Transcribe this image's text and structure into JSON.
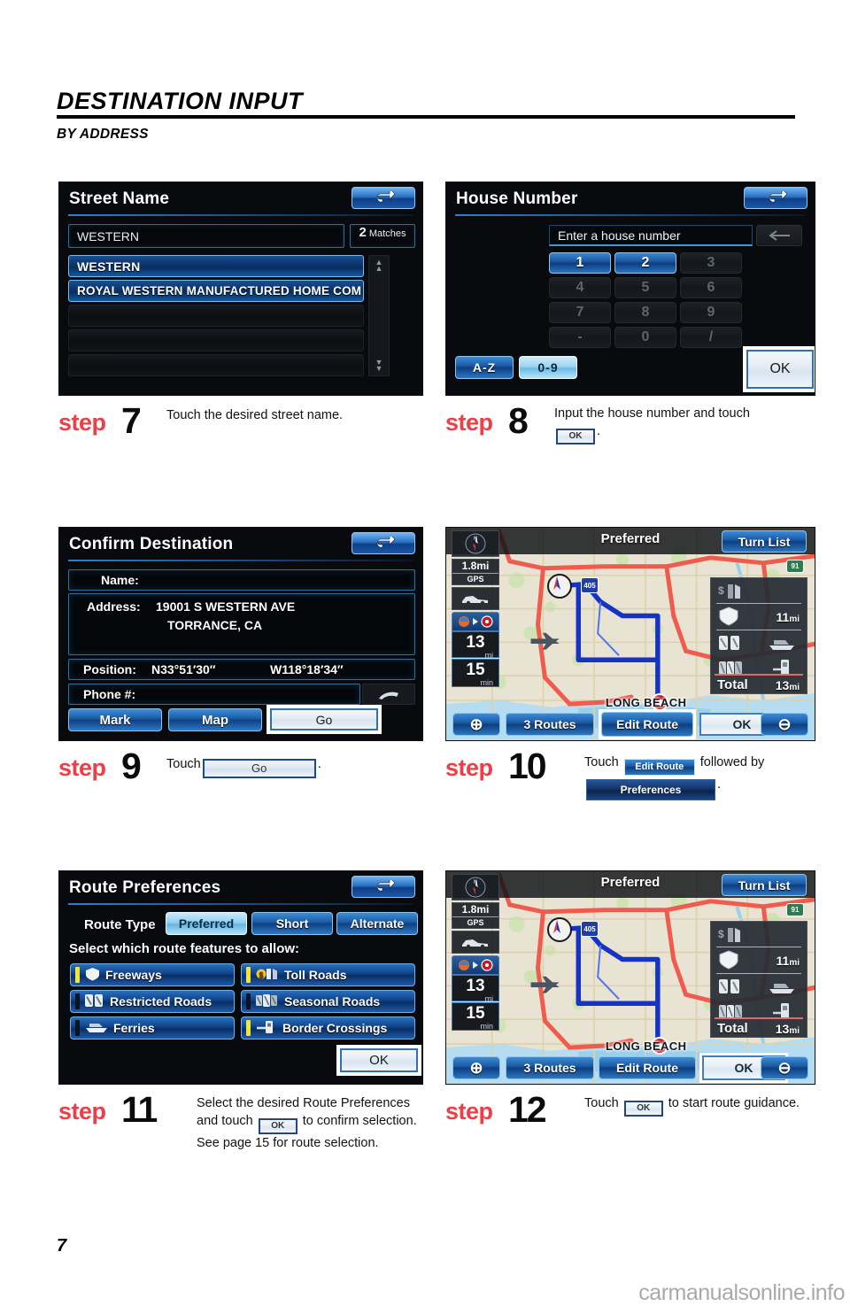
{
  "header": {
    "title": "DESTINATION INPUT",
    "subtitle": "BY ADDRESS"
  },
  "footer": {
    "page_number": "7",
    "watermark": "carmanualsonline.info"
  },
  "steps": [
    {
      "word": "step",
      "number": "7",
      "text_before": "Touch the desired street name.",
      "text_after": ""
    },
    {
      "word": "step",
      "number": "8",
      "text_before": "Input the house number and touch",
      "button": "OK",
      "text_after": "."
    },
    {
      "word": "step",
      "number": "9",
      "text_before": "Touch",
      "button": "Go",
      "text_after": "."
    },
    {
      "word": "step",
      "number": "10",
      "text_before": "Touch",
      "button": "Edit Route",
      "text_mid": "followed by",
      "button2": "Preferences",
      "text_after": "."
    },
    {
      "word": "step",
      "number": "11",
      "text_before": "Select the desired Route Preferences and touch",
      "button": "OK",
      "text_after": "to confirm selection. See page 15 for route selection."
    },
    {
      "word": "step",
      "number": "12",
      "text_before": "Touch",
      "button": "OK",
      "text_after": "to start route guidance."
    }
  ],
  "screen_street_name": {
    "title": "Street Name",
    "back_icon": "back-arrow-icon",
    "search_value": "WESTERN",
    "matches_count": "2",
    "matches_label": "Matches",
    "results": [
      "WESTERN",
      "ROYAL WESTERN MANUFACTURED HOME COM"
    ],
    "scroll_up_icon": "scroll-up-icon",
    "scroll_down_icon": "scroll-down-icon"
  },
  "screen_house_number": {
    "title": "House Number",
    "back_icon": "back-arrow-icon",
    "input_placeholder": "Enter a house number",
    "backspace_icon": "backspace-arrow-icon",
    "keys": [
      {
        "label": "1",
        "enabled": true
      },
      {
        "label": "2",
        "enabled": true
      },
      {
        "label": "3",
        "enabled": false
      },
      {
        "label": "4",
        "enabled": false
      },
      {
        "label": "5",
        "enabled": false
      },
      {
        "label": "6",
        "enabled": false
      },
      {
        "label": "7",
        "enabled": false
      },
      {
        "label": "8",
        "enabled": false
      },
      {
        "label": "9",
        "enabled": false
      },
      {
        "label": "-",
        "enabled": false
      },
      {
        "label": "0",
        "enabled": false
      },
      {
        "label": "/",
        "enabled": false
      }
    ],
    "tab_az": "A-Z",
    "tab_09": "0-9",
    "ok_label": "OK"
  },
  "screen_confirm_destination": {
    "title": "Confirm Destination",
    "back_icon": "back-arrow-icon",
    "name_label": "Name:",
    "name_value": "",
    "address_label": "Address:",
    "address_line1": "19001 S WESTERN AVE",
    "address_line2": "TORRANCE, CA",
    "position_label": "Position:",
    "position_lat": "N33°51′30″",
    "position_lon": "W118°18′34″",
    "phone_label": "Phone #:",
    "phone_icon": "phone-icon",
    "buttons": {
      "mark": "Mark",
      "map": "Map",
      "go": "Go"
    }
  },
  "screen_route_map": {
    "route_type": "Preferred",
    "turn_list": "Turn List",
    "compass_icon": "compass-north-icon",
    "gps_distance": "1.8mi",
    "gps_label": "GPS",
    "vehicle_icon": "vehicle-icon",
    "route_icon": "route-indicator-icon",
    "distance_value": "13",
    "distance_unit": "mi",
    "time_value": "15",
    "time_unit": "min",
    "city_label": "LONG BEACH",
    "airport_icon": "airport-icon",
    "highway_shield_405": "405",
    "highway_shield_91": "91",
    "legend": {
      "toll_icon": "toll-road-icon",
      "freeway_icon": "freeway-icon",
      "freeway_value": "11",
      "freeway_unit": "mi",
      "restricted_icon": "restricted-road-icon",
      "ferry_icon": "ferry-icon",
      "seasonal_icon": "seasonal-road-icon",
      "border_icon": "border-crossing-icon",
      "total_label": "Total",
      "total_value": "13",
      "total_unit": "mi"
    },
    "zoom_in_icon": "zoom-in-icon",
    "zoom_out_icon": "zoom-out-icon",
    "routes_button": "3 Routes",
    "edit_route_button": "Edit Route",
    "ok_button": "OK"
  },
  "screen_route_preferences": {
    "title": "Route Preferences",
    "back_icon": "back-arrow-icon",
    "route_type_label": "Route Type",
    "route_types": [
      {
        "label": "Preferred",
        "selected": true
      },
      {
        "label": "Short",
        "selected": false
      },
      {
        "label": "Alternate",
        "selected": false
      }
    ],
    "features_label": "Select which route features to allow:",
    "features": [
      {
        "label": "Freeways",
        "icon": "freeway-icon",
        "allowed": true
      },
      {
        "label": "Toll Roads",
        "icon": "toll-road-icon",
        "allowed": true
      },
      {
        "label": "Restricted Roads",
        "icon": "restricted-road-icon",
        "allowed": false
      },
      {
        "label": "Seasonal Roads",
        "icon": "seasonal-road-icon",
        "allowed": false
      },
      {
        "label": "Ferries",
        "icon": "ferry-icon",
        "allowed": false
      },
      {
        "label": "Border Crossings",
        "icon": "border-crossing-icon",
        "allowed": true
      }
    ],
    "ok_label": "OK"
  }
}
